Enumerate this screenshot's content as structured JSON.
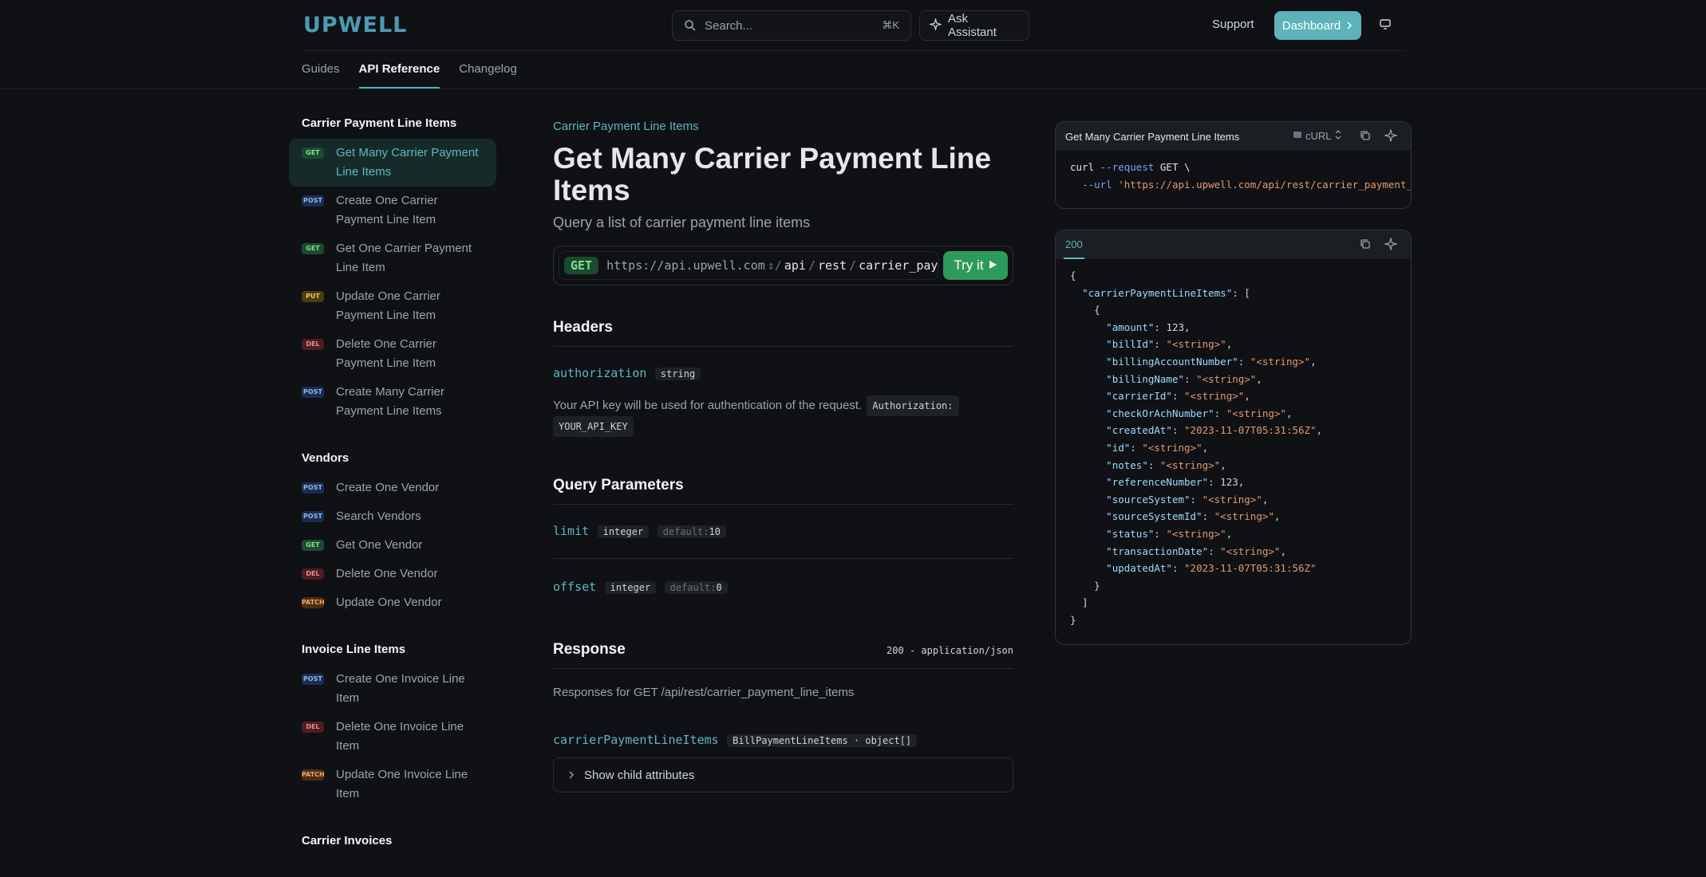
{
  "header": {
    "logo": "UPWELL",
    "search_placeholder": "Search...",
    "search_shortcut": "⌘K",
    "ask_assistant": "Ask Assistant",
    "support": "Support",
    "dashboard": "Dashboard"
  },
  "tabs": [
    {
      "label": "Guides"
    },
    {
      "label": "API Reference"
    },
    {
      "label": "Changelog"
    }
  ],
  "sidebar": {
    "sections": [
      {
        "title": "Carrier Payment Line Items",
        "items": [
          {
            "method": "GET",
            "label": "Get Many Carrier Payment Line Items"
          },
          {
            "method": "POST",
            "label": "Create One Carrier Payment Line Item"
          },
          {
            "method": "GET",
            "label": "Get One Carrier Payment Line Item"
          },
          {
            "method": "PUT",
            "label": "Update One Carrier Payment Line Item"
          },
          {
            "method": "DEL",
            "label": "Delete One Carrier Payment Line Item"
          },
          {
            "method": "POST",
            "label": "Create Many Carrier Payment Line Items"
          }
        ]
      },
      {
        "title": "Vendors",
        "items": [
          {
            "method": "POST",
            "label": "Create One Vendor"
          },
          {
            "method": "POST",
            "label": "Search Vendors"
          },
          {
            "method": "GET",
            "label": "Get One Vendor"
          },
          {
            "method": "DEL",
            "label": "Delete One Vendor"
          },
          {
            "method": "PATCH",
            "label": "Update One Vendor"
          }
        ]
      },
      {
        "title": "Invoice Line Items",
        "items": [
          {
            "method": "POST",
            "label": "Create One Invoice Line Item"
          },
          {
            "method": "DEL",
            "label": "Delete One Invoice Line Item"
          },
          {
            "method": "PATCH",
            "label": "Update One Invoice Line Item"
          }
        ]
      },
      {
        "title": "Carrier Invoices",
        "items": []
      }
    ]
  },
  "main": {
    "eyebrow": "Carrier Payment Line Items",
    "title": "Get Many Carrier Payment Line Items",
    "subtitle": "Query a list of carrier payment line items",
    "method": "GET",
    "url_base": "https://api.upwell.com",
    "url_segments": [
      "api",
      "rest",
      "carrier_payment"
    ],
    "try_it": "Try it",
    "headers_title": "Headers",
    "auth_name": "authorization",
    "auth_type": "string",
    "auth_desc": "Your API key will be used for authentication of the request.",
    "auth_code_1": "Authorization:",
    "auth_code_2": "YOUR_API_KEY",
    "query_title": "Query Parameters",
    "limit_name": "limit",
    "limit_type": "integer",
    "limit_default_label": "default:",
    "limit_default": "10",
    "offset_name": "offset",
    "offset_type": "integer",
    "offset_default_label": "default:",
    "offset_default": "0",
    "response_title": "Response",
    "response_ct": "200 - application/json",
    "response_desc": "Responses for GET /api/rest/carrier_payment_line_items",
    "resp_field": "carrierPaymentLineItems",
    "resp_field_type": "BillPaymentLineItems · object[]",
    "show_child": "Show child attributes"
  },
  "request_panel": {
    "title": "Get Many Carrier Payment Line Items",
    "lang": "cURL",
    "line1_cmd": "curl",
    "line1_flag": "--request",
    "line1_method": "GET",
    "line1_tail": " \\",
    "line2_flag": "--url",
    "line2_url": "'https://api.upwell.com/api/rest/carrier_payment_line_items'"
  },
  "response_panel": {
    "status": "200",
    "root_key": "carrierPaymentLineItems",
    "fields": [
      {
        "key": "amount",
        "value": "123",
        "is_string": false
      },
      {
        "key": "billId",
        "value": "\"<string>\"",
        "is_string": true
      },
      {
        "key": "billingAccountNumber",
        "value": "\"<string>\"",
        "is_string": true
      },
      {
        "key": "billingName",
        "value": "\"<string>\"",
        "is_string": true
      },
      {
        "key": "carrierId",
        "value": "\"<string>\"",
        "is_string": true
      },
      {
        "key": "checkOrAchNumber",
        "value": "\"<string>\"",
        "is_string": true
      },
      {
        "key": "createdAt",
        "value": "\"2023-11-07T05:31:56Z\"",
        "is_string": true
      },
      {
        "key": "id",
        "value": "\"<string>\"",
        "is_string": true
      },
      {
        "key": "notes",
        "value": "\"<string>\"",
        "is_string": true
      },
      {
        "key": "referenceNumber",
        "value": "123",
        "is_string": false
      },
      {
        "key": "sourceSystem",
        "value": "\"<string>\"",
        "is_string": true
      },
      {
        "key": "sourceSystemId",
        "value": "\"<string>\"",
        "is_string": true
      },
      {
        "key": "status",
        "value": "\"<string>\"",
        "is_string": true
      },
      {
        "key": "transactionDate",
        "value": "\"<string>\"",
        "is_string": true
      },
      {
        "key": "updatedAt",
        "value": "\"2023-11-07T05:31:56Z\"",
        "is_string": true
      }
    ]
  },
  "colors": {
    "accent": "#5eb9be",
    "try_it": "#2e9a5a",
    "dashboard": "#5db3b9",
    "background": "#0f1115"
  },
  "icons": [
    "search-icon",
    "sparkle-icon",
    "chevron-right-icon",
    "monitor-icon",
    "terminal-icon",
    "up-down-chevron-icon",
    "copy-icon",
    "play-icon"
  ]
}
